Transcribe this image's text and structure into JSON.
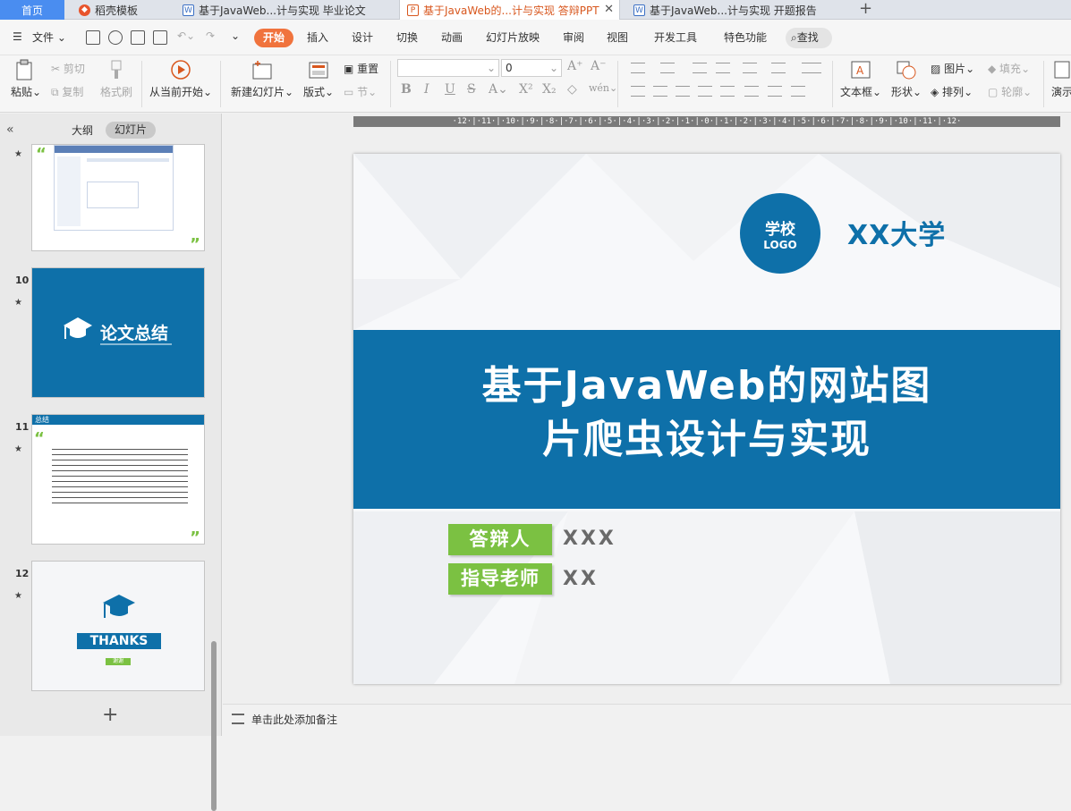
{
  "tabs": [
    {
      "label": "首页",
      "kind": "home"
    },
    {
      "label": "稻壳模板",
      "kind": "docer",
      "icon": "docer-icon"
    },
    {
      "label": "基于JavaWeb...计与实现 毕业论文",
      "kind": "writer",
      "icon": "writer-doc-icon"
    },
    {
      "label": "基于JavaWeb的...计与实现 答辩PPT",
      "kind": "presentation",
      "icon": "presentation-icon",
      "active": true
    },
    {
      "label": "基于JavaWeb...计与实现 开题报告",
      "kind": "writer",
      "icon": "writer-doc-icon"
    }
  ],
  "menu": {
    "file": "文件",
    "items": [
      "开始",
      "插入",
      "设计",
      "切换",
      "动画",
      "幻灯片放映",
      "审阅",
      "视图",
      "开发工具",
      "特色功能"
    ],
    "active": "开始",
    "search": "查找"
  },
  "toolbar": {
    "paste": "粘贴",
    "cut": "剪切",
    "copy": "复制",
    "format_painter": "格式刷",
    "from_current": "从当前开始",
    "new_slide": "新建幻灯片",
    "layout": "版式",
    "reset": "重置",
    "section": "节",
    "font_size": "0",
    "textbox": "文本框",
    "shape": "形状",
    "picture": "图片",
    "arrange": "排列",
    "fill": "填充",
    "outline": "轮廓",
    "present": "演示"
  },
  "left_pane": {
    "outline_tab": "大纲",
    "slides_tab": "幻灯片",
    "thumbnails": [
      {
        "number": "",
        "kind": "screenshot"
      },
      {
        "number": "10",
        "kind": "section",
        "title": "论文总结"
      },
      {
        "number": "11",
        "kind": "text",
        "heading": "总结"
      },
      {
        "number": "12",
        "kind": "thanks",
        "title": "THANKS",
        "badge": "谢谢"
      }
    ]
  },
  "slide": {
    "logo_line1": "学校",
    "logo_line2": "LOGO",
    "university": "XX大学",
    "title_line1": "基于JavaWeb的网站图",
    "title_line2": "片爬虫设计与实现",
    "defender_label": "答辩人",
    "defender_value": "XXX",
    "advisor_label": "指导老师",
    "advisor_value": "XX"
  },
  "ruler_text": "·12·|·11·|·10·|·9·|·8·|·7·|·6·|·5·|·4·|·3·|·2·|·1·|·0·|·1·|·2·|·3·|·4·|·5·|·6·|·7·|·8·|·9·|·10·|·11·|·12·",
  "notes_placeholder": "单击此处添加备注",
  "colors": {
    "accent": "#0e70a9",
    "green": "#7bc142",
    "start_tab": "#f0733d"
  }
}
